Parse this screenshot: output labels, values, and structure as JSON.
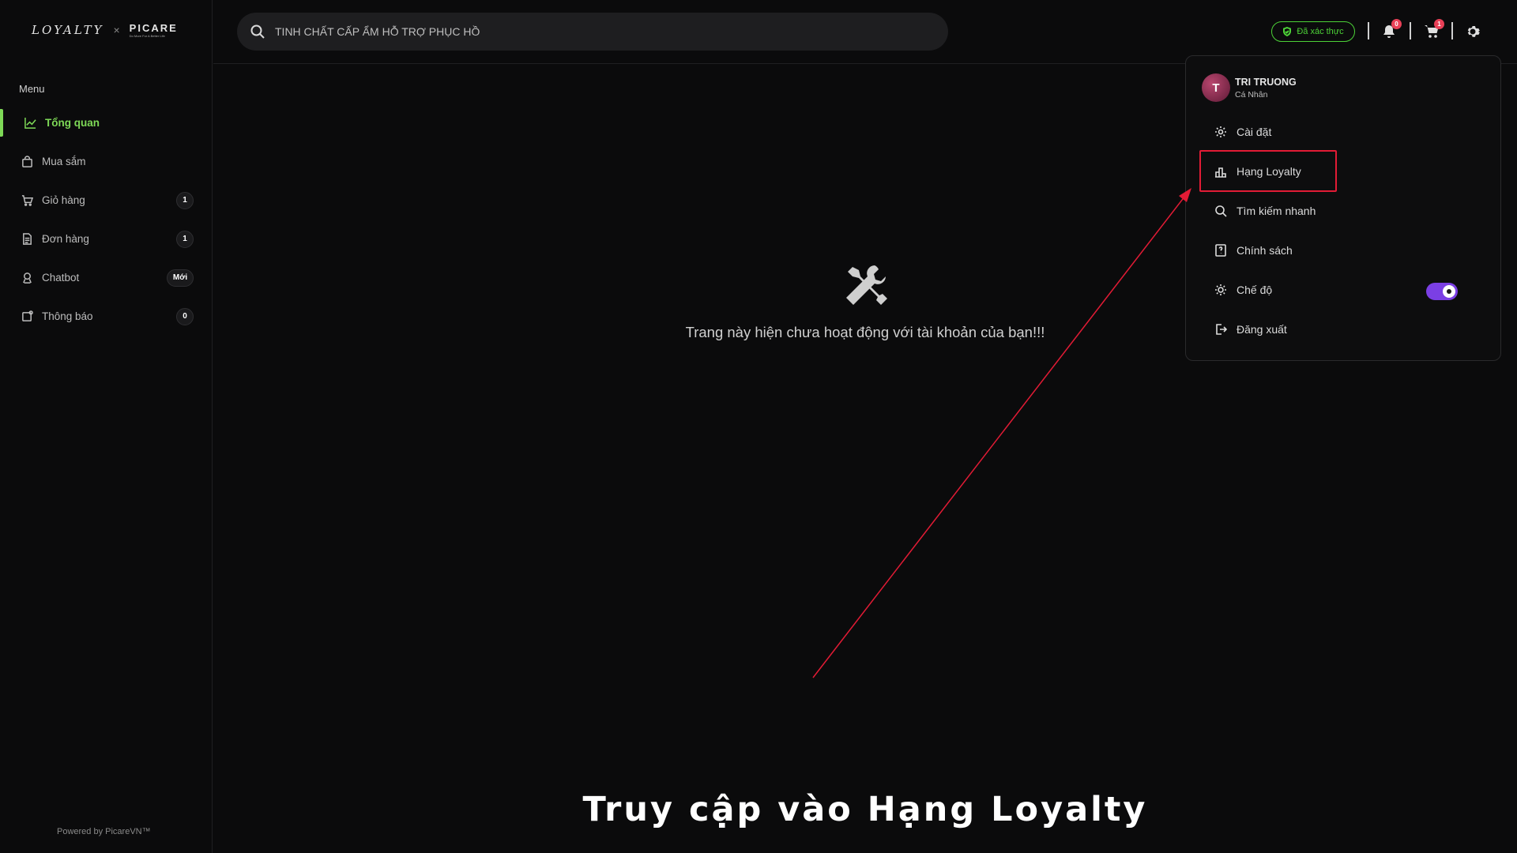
{
  "brand": {
    "loyalty": "LOYALTY",
    "separator": "×",
    "partner": "PICARE",
    "partner_tagline": "Do More For A Better Life"
  },
  "sidebar": {
    "menu_title": "Menu",
    "items": [
      {
        "label": "Tổng quan",
        "icon": "chart-line-icon",
        "badge": ""
      },
      {
        "label": "Mua sắm",
        "icon": "shopping-bag-icon",
        "badge": ""
      },
      {
        "label": "Giỏ hàng",
        "icon": "cart-icon",
        "badge": "1"
      },
      {
        "label": "Đơn hàng",
        "icon": "document-icon",
        "badge": "1"
      },
      {
        "label": "Chatbot",
        "icon": "bot-icon",
        "badge": "Mới"
      },
      {
        "label": "Thông báo",
        "icon": "notification-icon",
        "badge": "0"
      }
    ],
    "footer": "Powered by PicareVN™"
  },
  "header": {
    "search_value": "TINH CHẤT CẤP ẨM HỖ TRỢ PHỤC HỒ",
    "verified_label": "Đã xác thực",
    "notification_count": "0",
    "cart_count": "1"
  },
  "main": {
    "empty_message": "Trang này hiện chưa hoạt động với tài khoản của bạn!!!"
  },
  "dropdown": {
    "user_initial": "T",
    "user_name": "TRI TRUONG",
    "user_role": "Cá Nhân",
    "items": [
      {
        "label": "Cài đặt",
        "icon": "gear-icon"
      },
      {
        "label": "Hạng Loyalty",
        "icon": "ranking-icon"
      },
      {
        "label": "Tìm kiếm nhanh",
        "icon": "search-icon"
      },
      {
        "label": "Chính sách",
        "icon": "policy-book-icon"
      },
      {
        "label": "Chế độ",
        "icon": "sun-icon"
      },
      {
        "label": "Đăng xuất",
        "icon": "logout-icon"
      }
    ],
    "theme_toggle_on": true
  },
  "colors": {
    "accent": "#7ed957",
    "verified": "#4cd137",
    "highlight": "#e21b35",
    "toggle": "#7b3fe4"
  },
  "caption": "Truy cập vào Hạng Loyalty"
}
